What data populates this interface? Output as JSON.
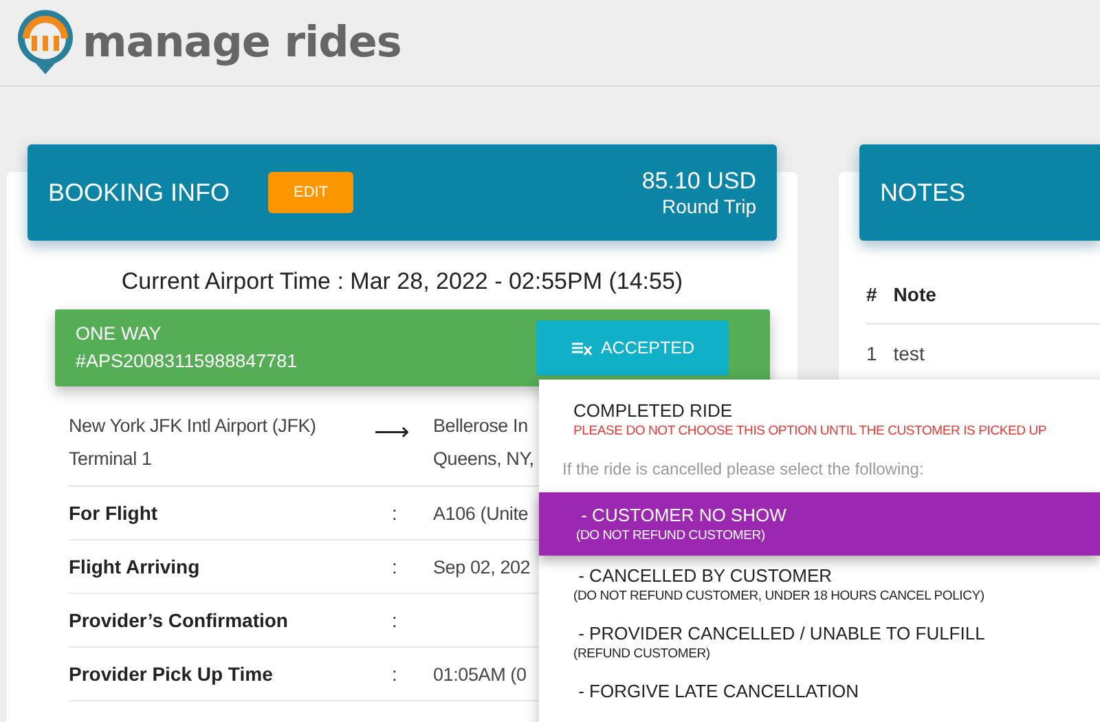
{
  "header": {
    "brand": "manage rides"
  },
  "booking": {
    "title": "BOOKING INFO",
    "edit_button": "EDIT",
    "price": "85.10 USD",
    "trip_type": "Round Trip",
    "airport_time": "Current Airport Time : Mar 28, 2022 - 02:55PM (14:55)",
    "ride": {
      "type": "ONE WAY",
      "id": "#APS20083115988847781",
      "status_button": "ACCEPTED"
    },
    "route": {
      "from": [
        "New York JFK Intl Airport (JFK)",
        "Terminal 1"
      ],
      "arrow": "⟶",
      "to": [
        "Bellerose In",
        "Queens, NY,"
      ]
    },
    "details": [
      {
        "label": "For Flight",
        "sep": ":",
        "value": "A106 (Unite"
      },
      {
        "label": "Flight Arriving",
        "sep": ":",
        "value": "Sep 02, 202"
      },
      {
        "label": "Provider’s Confirmation",
        "sep": ":"
      },
      {
        "label": "Provider Pick Up Time",
        "sep": ":",
        "value": "01:05AM (0"
      }
    ]
  },
  "notes": {
    "title": "NOTES",
    "columns": [
      "#",
      "Note"
    ],
    "rows": [
      [
        "1",
        "test"
      ]
    ]
  },
  "status_menu": [
    {
      "kind": "option",
      "title": "COMPLETED RIDE",
      "subtitle": "PLEASE DO NOT CHOOSE THIS OPTION UNTIL THE CUSTOMER IS PICKED UP",
      "warning": true,
      "selected": false
    },
    {
      "kind": "hint",
      "title": "If the ride is cancelled please select the following:"
    },
    {
      "kind": "option",
      "title": " - CUSTOMER NO SHOW",
      "subtitle": "(DO NOT REFUND CUSTOMER)",
      "selected": true
    },
    {
      "kind": "option",
      "title": " - CANCELLED BY CUSTOMER",
      "subtitle": "(DO NOT REFUND CUSTOMER, UNDER 18 HOURS CANCEL POLICY)",
      "selected": false
    },
    {
      "kind": "option",
      "title": " - PROVIDER CANCELLED / UNABLE TO FULFILL",
      "subtitle": "(REFUND CUSTOMER)",
      "selected": false
    },
    {
      "kind": "option",
      "title": " - FORGIVE LATE CANCELLATION",
      "selected": false
    }
  ]
}
